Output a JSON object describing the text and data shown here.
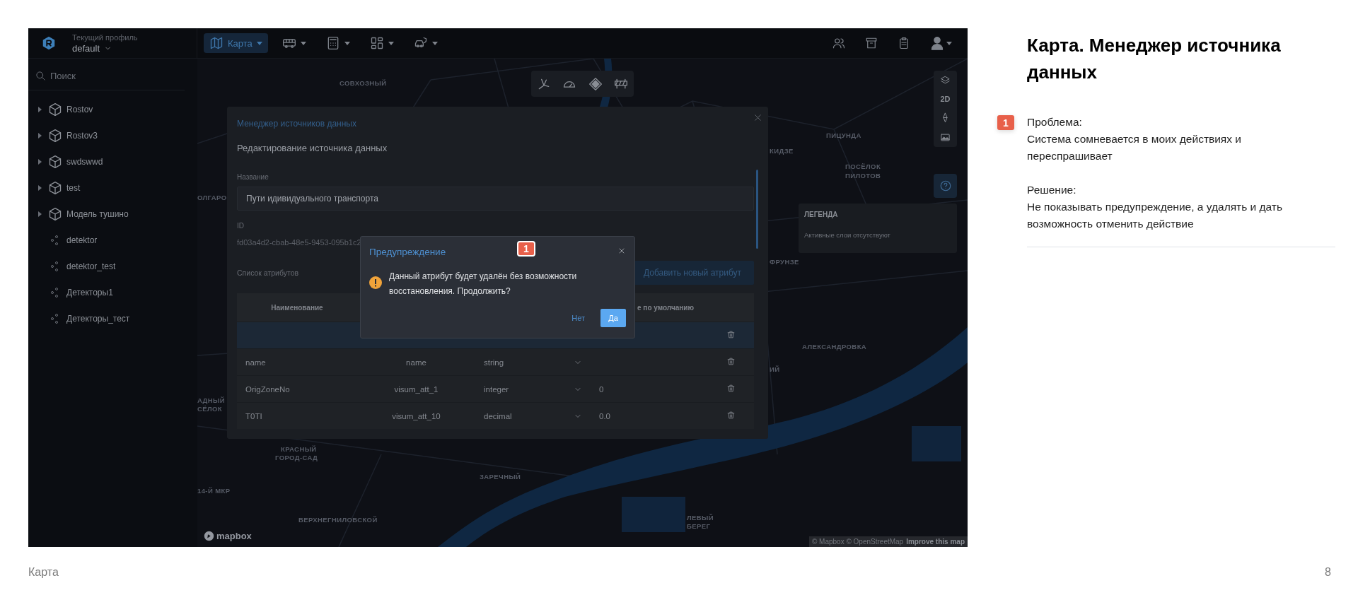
{
  "slide": {
    "title": "Карта. Менеджер источника данных",
    "footer": "Карта",
    "page_number": "8"
  },
  "notes": [
    {
      "marker": "1",
      "problem_label": "Проблема:",
      "problem": "Система сомневается в моих действиях и переспрашивает",
      "solution_label": "Решение:",
      "solution": "Не показывать предупреждение, а удалять и дать возможность отменить действие"
    }
  ],
  "header": {
    "profile_label": "Текущий профиль",
    "profile": "default",
    "nav": [
      {
        "kind": "map",
        "label": "Карта",
        "selected": true
      },
      {
        "kind": "bus",
        "selected": false
      },
      {
        "kind": "calculator",
        "selected": false
      },
      {
        "kind": "dashboard",
        "selected": false
      },
      {
        "kind": "car",
        "selected": false
      }
    ]
  },
  "sidebar": {
    "search_placeholder": "Поиск",
    "items": [
      {
        "kind": "group",
        "label": "Rostov"
      },
      {
        "kind": "group",
        "label": "Rostov3"
      },
      {
        "kind": "group",
        "label": "swdswwd"
      },
      {
        "kind": "group",
        "label": "test"
      },
      {
        "kind": "group",
        "label": "Модель тушино"
      },
      {
        "kind": "layer",
        "label": "detektor"
      },
      {
        "kind": "layer",
        "label": "detektor_test"
      },
      {
        "kind": "layer",
        "label": "Детекторы1"
      },
      {
        "kind": "layer",
        "label": "Детекторы_тест"
      }
    ]
  },
  "map": {
    "labels": [
      "СОВХОЗНЫЙ",
      "ОЛГАРО",
      "ПИЦУНДА",
      "КИДЗЕ",
      "ПОСЁЛОК",
      "ПИЛОТОВ",
      "ФРУНЗЕ",
      "АЛЕКСАНДРОВКА",
      "ИЙ",
      "АДНЫЙ",
      "СЁЛОК",
      "КРАСНЫЙ",
      "ГОРОД-САД",
      "14-Й МКР",
      "ЗАРЕЧНЫЙ",
      "ВЕРХНЕГНИЛОВСКОЙ",
      "ЛЕВЫЙ",
      "БЕРЕГ"
    ],
    "mode_label": "2D",
    "legend": {
      "title": "ЛЕГЕНДА",
      "text": "Активные слои отсутствуют"
    },
    "logo": "mapbox",
    "attribution": "© Mapbox © OpenStreetMap",
    "improve_link": "Improve this map"
  },
  "modal": {
    "back_link": "Менеджер источников данных",
    "title": "Редактирование источника данных",
    "name_label": "Название",
    "name_value": "Пути идивидуального транспорта",
    "id_label": "ID",
    "id_value": "fd03a4d2-cbab-48e5-9453-095b1c2",
    "attributes_label": "Список атрибутов",
    "add_button": "Добавить новый атрибут",
    "table": {
      "columns": {
        "column_1": "Наименование",
        "column_4": "е по умолчанию"
      },
      "rows": [
        {
          "selected": true
        },
        {
          "selected": false,
          "name": "name",
          "field": "name",
          "type": "string"
        },
        {
          "selected": false,
          "name": "OrigZoneNo",
          "field": "visum_att_1",
          "type": "integer",
          "default": "0"
        },
        {
          "selected": false,
          "name": "T0TI",
          "field": "visum_att_10",
          "type": "decimal",
          "default": "0.0"
        }
      ]
    }
  },
  "dialog": {
    "title": "Предупреждение",
    "message": "Данный атрибут будет удалён без возможности восстановления. Продолжить?",
    "marker": "1",
    "buttons": [
      {
        "kind": "link",
        "label": "Нет"
      },
      {
        "kind": "primary",
        "label": "Да"
      }
    ]
  }
}
